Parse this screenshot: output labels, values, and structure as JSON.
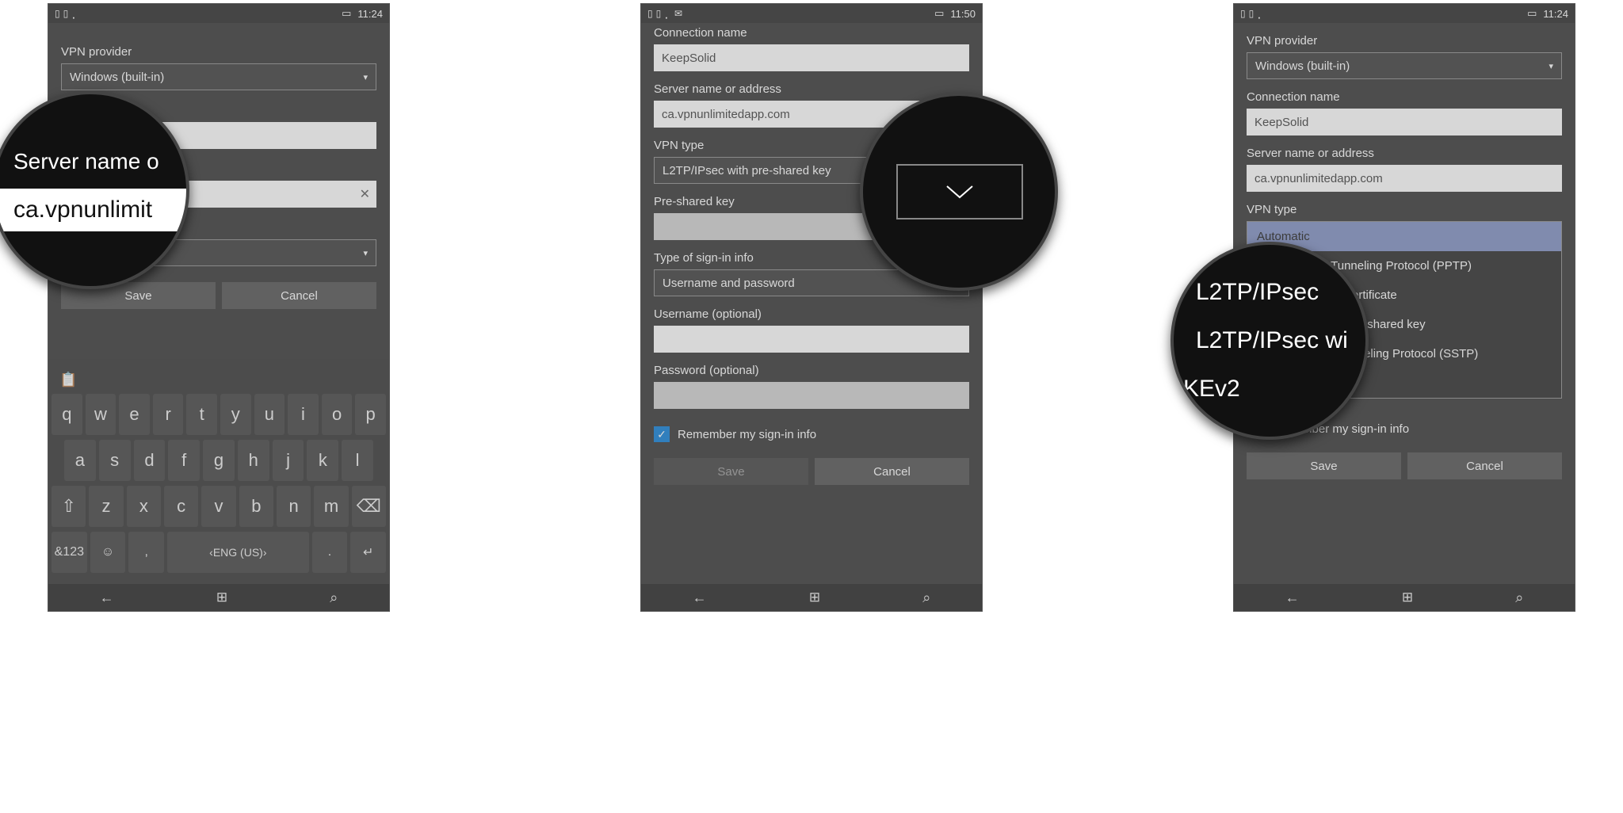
{
  "statusbar": {
    "time1": "11:24",
    "time2": "11:50",
    "time3": "11:24"
  },
  "labels": {
    "vpn_provider": "VPN provider",
    "connection_name": "Connection name",
    "server_name": "Server name or address",
    "vpn_type": "VPN type",
    "preshared": "Pre-shared key",
    "signin_type": "Type of sign-in info",
    "username": "Username (optional)",
    "password": "Password (optional)",
    "remember": "Remember my sign-in info"
  },
  "values": {
    "provider": "Windows (built-in)",
    "connection": "KeepSolid",
    "server": "ca.vpnunlimitedapp.com",
    "vpn_type": "L2TP/IPsec with pre-shared key",
    "signin": "Username and password"
  },
  "buttons": {
    "save": "Save",
    "cancel": "Cancel"
  },
  "keyboard": {
    "row1": [
      "q",
      "w",
      "e",
      "r",
      "t",
      "y",
      "u",
      "i",
      "o",
      "p"
    ],
    "row2": [
      "a",
      "s",
      "d",
      "f",
      "g",
      "h",
      "j",
      "k",
      "l"
    ],
    "row3": [
      "⇧",
      "z",
      "x",
      "c",
      "v",
      "b",
      "n",
      "m",
      "⌫"
    ],
    "row4_numsym": "&123",
    "row4_lang": "ENG (US)",
    "row4_emoji": "☺",
    "row4_comma": ",",
    "row4_dot": ".",
    "row4_enter": "↵"
  },
  "vpn_type_options": [
    "Automatic",
    "Point to Point Tunneling Protocol (PPTP)",
    "L2TP/IPsec with certificate",
    "L2TP/IPsec with pre-shared key",
    "Secure Socket Tunneling Protocol (SSTP)",
    "IKEv2"
  ],
  "zoom1": {
    "label": "Server name o",
    "value": "ca.vpnunlimit"
  },
  "zoom3": {
    "line1": "L2TP/IPsec",
    "line2": "L2TP/IPsec wi",
    "line3": "KEv2"
  }
}
